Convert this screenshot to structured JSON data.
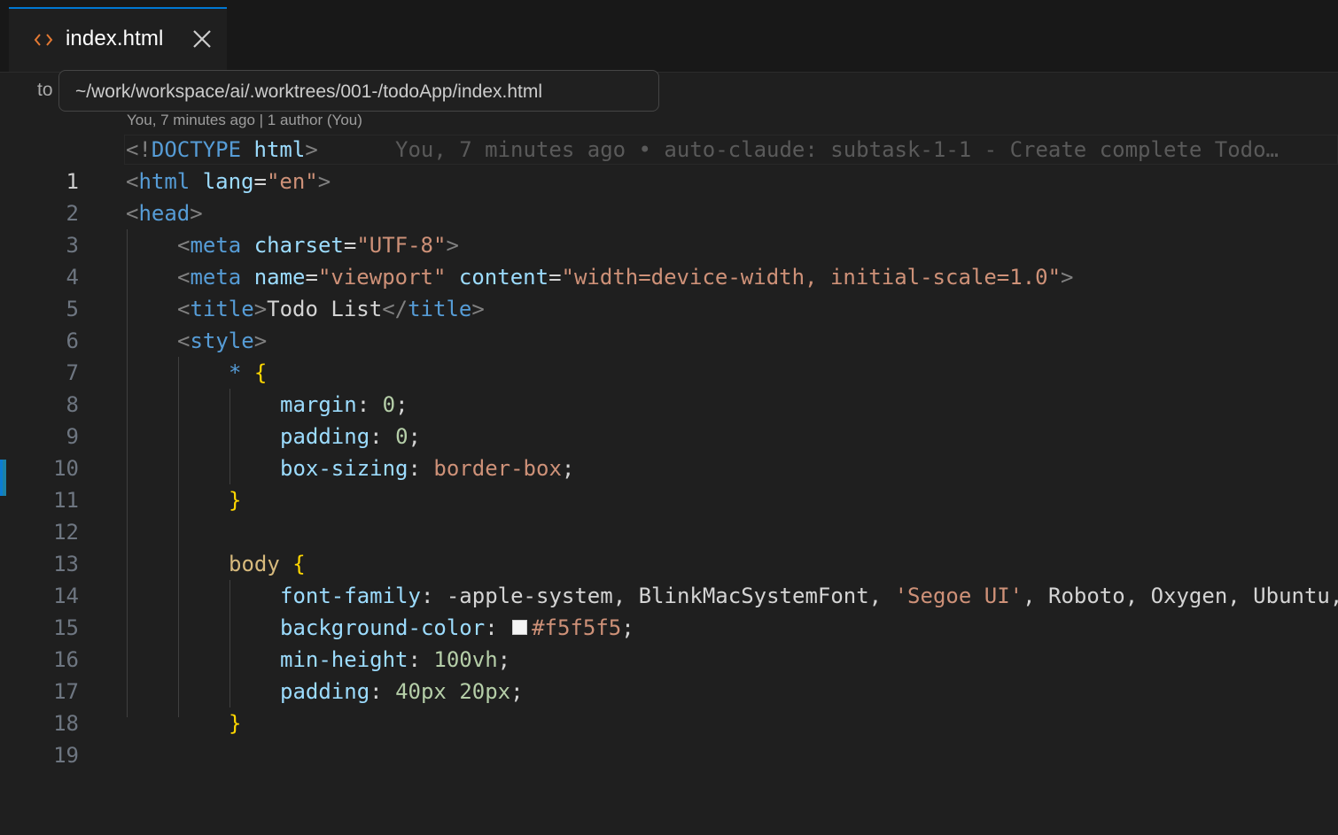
{
  "tab": {
    "label": "index.html",
    "icon": "code-brackets-icon",
    "close_icon": "close-icon",
    "accent_color": "#0078d4",
    "icon_color": "#e37933"
  },
  "breadcrumb": {
    "text": "to"
  },
  "tooltip": {
    "path": "~/work/workspace/ai/.worktrees/001-/todoApp/index.html"
  },
  "codelens": {
    "text": "You, 7 minutes ago | 1 author (You)"
  },
  "blame": {
    "line1": "You, 7 minutes ago • auto-claude: subtask-1-1 - Create complete Todo…"
  },
  "colors": {
    "background": "#1f1f1f",
    "tag": "#569cd6",
    "attribute": "#9cdcfe",
    "string": "#ce9178",
    "selector": "#d7ba7d",
    "brace": "#ffd700",
    "number": "#b5cea8",
    "line_number": "#6e7681",
    "color_swatch": "#f5f5f5"
  },
  "editor": {
    "active_line": 1,
    "lines": [
      {
        "n": "1",
        "t": {
          "lt": "<!",
          "kw": "DOCTYPE",
          "sp": " ",
          "attr": "html",
          "gt": ">"
        }
      },
      {
        "n": "2",
        "t": {
          "lt": "<",
          "tag": "html",
          "sp": " ",
          "attr": "lang",
          "eq": "=",
          "val": "\"en\"",
          "gt": ">"
        }
      },
      {
        "n": "3",
        "t": {
          "lt": "<",
          "tag": "head",
          "gt": ">"
        }
      },
      {
        "n": "4",
        "t": {
          "lt": "<",
          "tag": "meta",
          "sp": " ",
          "attr": "charset",
          "eq": "=",
          "val": "\"UTF-8\"",
          "gt": ">"
        }
      },
      {
        "n": "5",
        "t": {
          "lt": "<",
          "tag": "meta",
          "sp": " ",
          "attr1": "name",
          "eq1": "=",
          "val1": "\"viewport\"",
          "sp2": " ",
          "attr2": "content",
          "eq2": "=",
          "val2": "\"width=device-width, initial-scale=1.0\"",
          "gt": ">"
        }
      },
      {
        "n": "6",
        "t": {
          "lt": "<",
          "tag": "title",
          "gt": ">",
          "text": "Todo List",
          "lt2": "</",
          "tag2": "title",
          "gt2": ">"
        }
      },
      {
        "n": "7",
        "t": {
          "lt": "<",
          "tag": "style",
          "gt": ">"
        }
      },
      {
        "n": "8",
        "t": {
          "sel": "*",
          "sp": " ",
          "brace": "{"
        }
      },
      {
        "n": "9",
        "t": {
          "prop": "margin",
          "colon": ": ",
          "num": "0",
          "semi": ";"
        }
      },
      {
        "n": "10",
        "t": {
          "prop": "padding",
          "colon": ": ",
          "num": "0",
          "semi": ";"
        }
      },
      {
        "n": "11",
        "t": {
          "prop": "box-sizing",
          "colon": ": ",
          "val": "border-box",
          "semi": ";"
        }
      },
      {
        "n": "12",
        "t": {
          "brace": "}"
        }
      },
      {
        "n": "13",
        "t": {}
      },
      {
        "n": "14",
        "t": {
          "sel": "body",
          "sp": " ",
          "brace": "{"
        }
      },
      {
        "n": "15",
        "t": {
          "prop": "font-family",
          "colon": ": ",
          "v1": "-apple-system, BlinkMacSystemFont, ",
          "str": "'Segoe UI'",
          "v2": ", Roboto, Oxygen, Ubuntu,"
        }
      },
      {
        "n": "16",
        "t": {
          "prop": "background-color",
          "colon": ": ",
          "val": "#f5f5f5",
          "semi": ";"
        }
      },
      {
        "n": "17",
        "t": {
          "prop": "min-height",
          "colon": ": ",
          "num": "100vh",
          "semi": ";"
        }
      },
      {
        "n": "18",
        "t": {
          "prop": "padding",
          "colon": ": ",
          "num": "40px",
          "sp": " ",
          "num2": "20px",
          "semi": ";"
        }
      },
      {
        "n": "19",
        "t": {
          "brace": "}"
        }
      }
    ]
  }
}
